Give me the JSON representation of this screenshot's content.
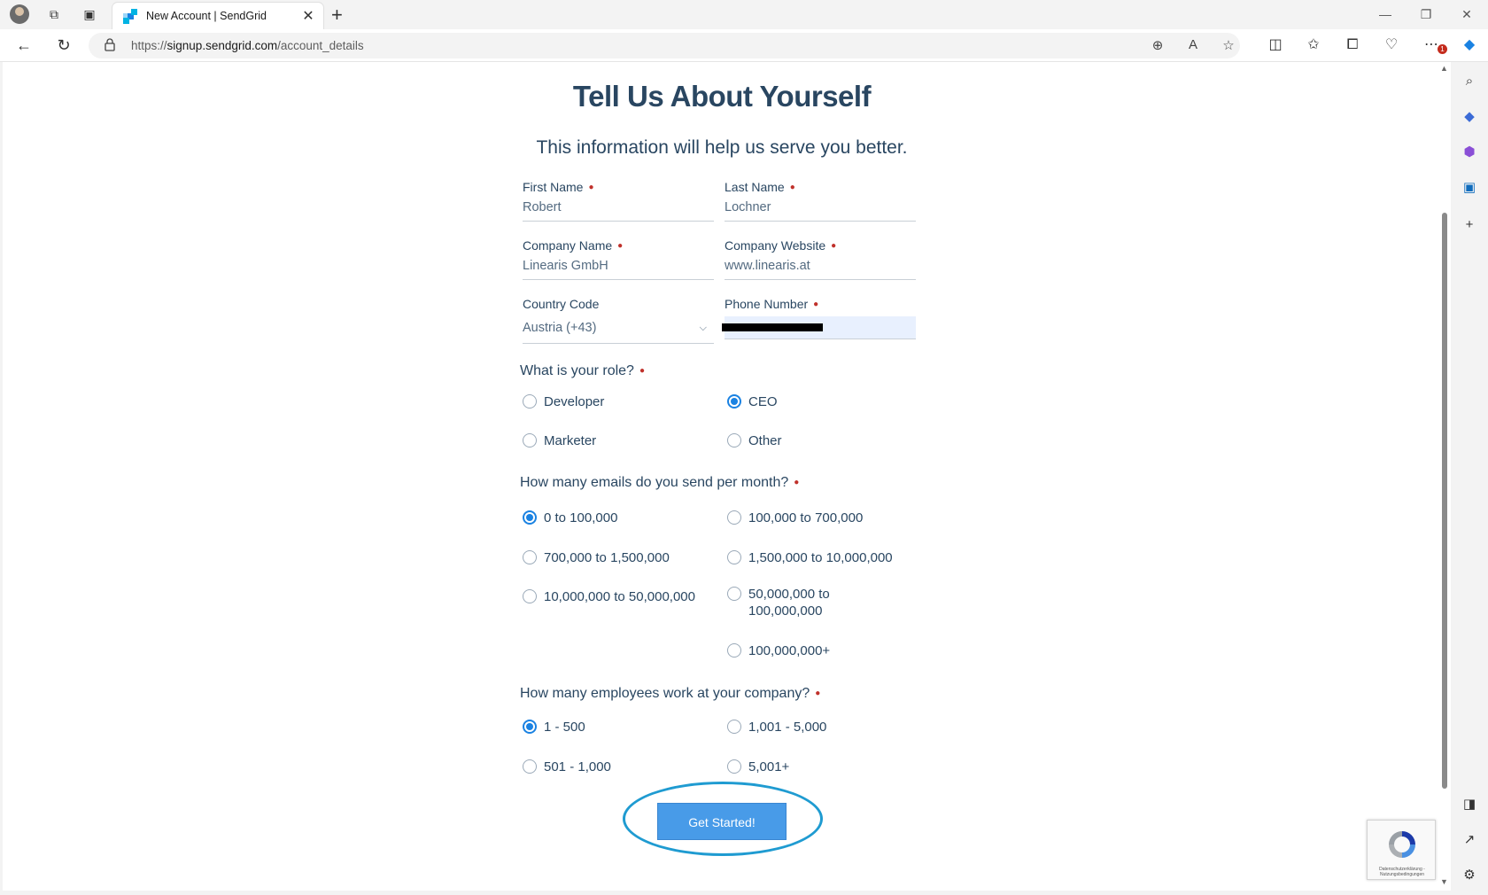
{
  "browser": {
    "tab_title": "New Account | SendGrid",
    "url_prefix": "https://",
    "url_host": "signup.sendgrid.com",
    "url_path": "/account_details",
    "notification_count": "1"
  },
  "form": {
    "heading": "Tell Us About Yourself",
    "subheading": "This information will help us serve you better.",
    "first_name": {
      "label": "First Name",
      "value": "Robert"
    },
    "last_name": {
      "label": "Last Name",
      "value": "Lochner"
    },
    "company_name": {
      "label": "Company Name",
      "value": "Linearis GmbH"
    },
    "company_website": {
      "label": "Company Website",
      "value": "www.linearis.at"
    },
    "country_code": {
      "label": "Country Code",
      "value": "Austria (+43)"
    },
    "phone_number": {
      "label": "Phone Number"
    },
    "role": {
      "question": "What is your role?",
      "options": [
        "Developer",
        "CEO",
        "Marketer",
        "Other"
      ],
      "selected": "CEO"
    },
    "emails": {
      "question": "How many emails do you send per month?",
      "options": [
        "0 to 100,000",
        "100,000 to 700,000",
        "700,000 to 1,500,000",
        "1,500,000 to 10,000,000",
        "10,000,000 to 50,000,000",
        "50,000,000 to",
        "100,000,000",
        "100,000,000+"
      ],
      "selected": "0 to 100,000"
    },
    "employees": {
      "question": "How many employees work at your company?",
      "options": [
        "1 - 500",
        "1,001 - 5,000",
        "501 - 1,000",
        "5,001+"
      ],
      "selected": "1 - 500"
    },
    "submit_label": "Get Started!"
  },
  "recaptcha": {
    "text": "Datenschutzerklärung - Nutzungsbedingungen"
  },
  "colors": {
    "heading": "#294661",
    "accent": "#1a82e2",
    "button": "#489be8",
    "required": "#c0312b",
    "annotation": "#1f9bd1"
  }
}
